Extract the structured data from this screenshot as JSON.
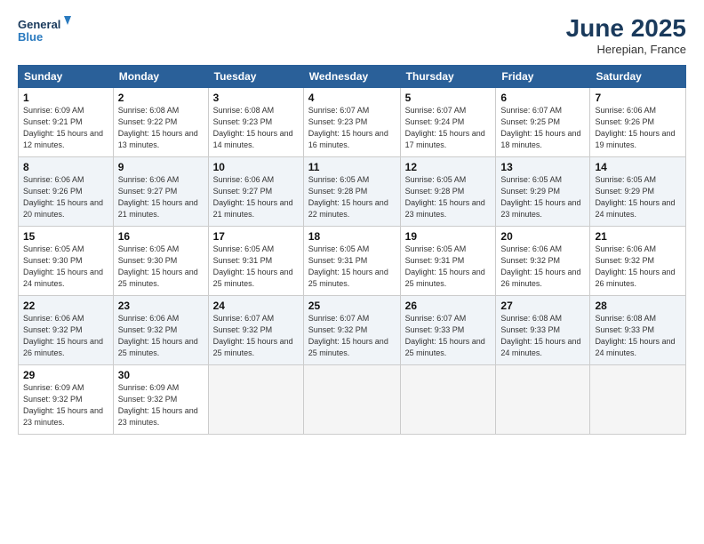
{
  "logo": {
    "line1": "General",
    "line2": "Blue"
  },
  "title": "June 2025",
  "location": "Herepian, France",
  "weekdays": [
    "Sunday",
    "Monday",
    "Tuesday",
    "Wednesday",
    "Thursday",
    "Friday",
    "Saturday"
  ],
  "weeks": [
    [
      {
        "day": "1",
        "sunrise": "Sunrise: 6:09 AM",
        "sunset": "Sunset: 9:21 PM",
        "daylight": "Daylight: 15 hours and 12 minutes."
      },
      {
        "day": "2",
        "sunrise": "Sunrise: 6:08 AM",
        "sunset": "Sunset: 9:22 PM",
        "daylight": "Daylight: 15 hours and 13 minutes."
      },
      {
        "day": "3",
        "sunrise": "Sunrise: 6:08 AM",
        "sunset": "Sunset: 9:23 PM",
        "daylight": "Daylight: 15 hours and 14 minutes."
      },
      {
        "day": "4",
        "sunrise": "Sunrise: 6:07 AM",
        "sunset": "Sunset: 9:23 PM",
        "daylight": "Daylight: 15 hours and 16 minutes."
      },
      {
        "day": "5",
        "sunrise": "Sunrise: 6:07 AM",
        "sunset": "Sunset: 9:24 PM",
        "daylight": "Daylight: 15 hours and 17 minutes."
      },
      {
        "day": "6",
        "sunrise": "Sunrise: 6:07 AM",
        "sunset": "Sunset: 9:25 PM",
        "daylight": "Daylight: 15 hours and 18 minutes."
      },
      {
        "day": "7",
        "sunrise": "Sunrise: 6:06 AM",
        "sunset": "Sunset: 9:26 PM",
        "daylight": "Daylight: 15 hours and 19 minutes."
      }
    ],
    [
      {
        "day": "8",
        "sunrise": "Sunrise: 6:06 AM",
        "sunset": "Sunset: 9:26 PM",
        "daylight": "Daylight: 15 hours and 20 minutes."
      },
      {
        "day": "9",
        "sunrise": "Sunrise: 6:06 AM",
        "sunset": "Sunset: 9:27 PM",
        "daylight": "Daylight: 15 hours and 21 minutes."
      },
      {
        "day": "10",
        "sunrise": "Sunrise: 6:06 AM",
        "sunset": "Sunset: 9:27 PM",
        "daylight": "Daylight: 15 hours and 21 minutes."
      },
      {
        "day": "11",
        "sunrise": "Sunrise: 6:05 AM",
        "sunset": "Sunset: 9:28 PM",
        "daylight": "Daylight: 15 hours and 22 minutes."
      },
      {
        "day": "12",
        "sunrise": "Sunrise: 6:05 AM",
        "sunset": "Sunset: 9:28 PM",
        "daylight": "Daylight: 15 hours and 23 minutes."
      },
      {
        "day": "13",
        "sunrise": "Sunrise: 6:05 AM",
        "sunset": "Sunset: 9:29 PM",
        "daylight": "Daylight: 15 hours and 23 minutes."
      },
      {
        "day": "14",
        "sunrise": "Sunrise: 6:05 AM",
        "sunset": "Sunset: 9:29 PM",
        "daylight": "Daylight: 15 hours and 24 minutes."
      }
    ],
    [
      {
        "day": "15",
        "sunrise": "Sunrise: 6:05 AM",
        "sunset": "Sunset: 9:30 PM",
        "daylight": "Daylight: 15 hours and 24 minutes."
      },
      {
        "day": "16",
        "sunrise": "Sunrise: 6:05 AM",
        "sunset": "Sunset: 9:30 PM",
        "daylight": "Daylight: 15 hours and 25 minutes."
      },
      {
        "day": "17",
        "sunrise": "Sunrise: 6:05 AM",
        "sunset": "Sunset: 9:31 PM",
        "daylight": "Daylight: 15 hours and 25 minutes."
      },
      {
        "day": "18",
        "sunrise": "Sunrise: 6:05 AM",
        "sunset": "Sunset: 9:31 PM",
        "daylight": "Daylight: 15 hours and 25 minutes."
      },
      {
        "day": "19",
        "sunrise": "Sunrise: 6:05 AM",
        "sunset": "Sunset: 9:31 PM",
        "daylight": "Daylight: 15 hours and 25 minutes."
      },
      {
        "day": "20",
        "sunrise": "Sunrise: 6:06 AM",
        "sunset": "Sunset: 9:32 PM",
        "daylight": "Daylight: 15 hours and 26 minutes."
      },
      {
        "day": "21",
        "sunrise": "Sunrise: 6:06 AM",
        "sunset": "Sunset: 9:32 PM",
        "daylight": "Daylight: 15 hours and 26 minutes."
      }
    ],
    [
      {
        "day": "22",
        "sunrise": "Sunrise: 6:06 AM",
        "sunset": "Sunset: 9:32 PM",
        "daylight": "Daylight: 15 hours and 26 minutes."
      },
      {
        "day": "23",
        "sunrise": "Sunrise: 6:06 AM",
        "sunset": "Sunset: 9:32 PM",
        "daylight": "Daylight: 15 hours and 25 minutes."
      },
      {
        "day": "24",
        "sunrise": "Sunrise: 6:07 AM",
        "sunset": "Sunset: 9:32 PM",
        "daylight": "Daylight: 15 hours and 25 minutes."
      },
      {
        "day": "25",
        "sunrise": "Sunrise: 6:07 AM",
        "sunset": "Sunset: 9:32 PM",
        "daylight": "Daylight: 15 hours and 25 minutes."
      },
      {
        "day": "26",
        "sunrise": "Sunrise: 6:07 AM",
        "sunset": "Sunset: 9:33 PM",
        "daylight": "Daylight: 15 hours and 25 minutes."
      },
      {
        "day": "27",
        "sunrise": "Sunrise: 6:08 AM",
        "sunset": "Sunset: 9:33 PM",
        "daylight": "Daylight: 15 hours and 24 minutes."
      },
      {
        "day": "28",
        "sunrise": "Sunrise: 6:08 AM",
        "sunset": "Sunset: 9:33 PM",
        "daylight": "Daylight: 15 hours and 24 minutes."
      }
    ],
    [
      {
        "day": "29",
        "sunrise": "Sunrise: 6:09 AM",
        "sunset": "Sunset: 9:32 PM",
        "daylight": "Daylight: 15 hours and 23 minutes."
      },
      {
        "day": "30",
        "sunrise": "Sunrise: 6:09 AM",
        "sunset": "Sunset: 9:32 PM",
        "daylight": "Daylight: 15 hours and 23 minutes."
      },
      null,
      null,
      null,
      null,
      null
    ]
  ]
}
